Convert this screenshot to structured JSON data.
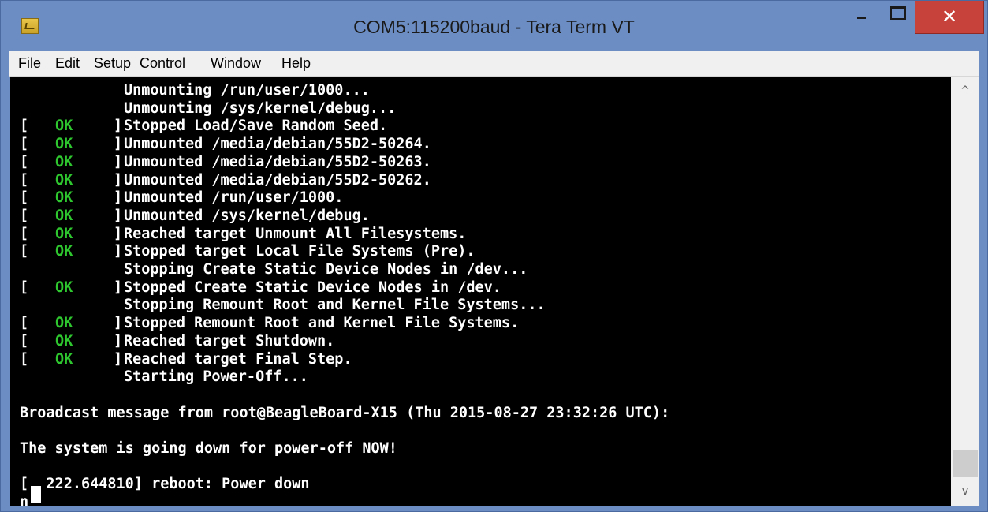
{
  "window": {
    "title": "COM5:115200baud - Tera Term VT",
    "close_glyph": "✕"
  },
  "menu": {
    "items": [
      {
        "accel": "F",
        "rest": "ile"
      },
      {
        "accel": "E",
        "rest": "dit"
      },
      {
        "accel": "S",
        "rest": "etup"
      },
      {
        "pre": "C",
        "accel": "o",
        "rest": "ntrol"
      },
      {
        "accel": "W",
        "rest": "indow"
      },
      {
        "accel": "H",
        "rest": "elp"
      }
    ]
  },
  "terminal": {
    "status_open": "[",
    "status_ok": "OK",
    "status_close": "]",
    "lines": [
      {
        "kind": "indent",
        "text": "Unmounting /run/user/1000..."
      },
      {
        "kind": "indent",
        "text": "Unmounting /sys/kernel/debug..."
      },
      {
        "kind": "ok",
        "text": "Stopped Load/Save Random Seed."
      },
      {
        "kind": "ok",
        "text": "Unmounted /media/debian/55D2-50264."
      },
      {
        "kind": "ok",
        "text": "Unmounted /media/debian/55D2-50263."
      },
      {
        "kind": "ok",
        "text": "Unmounted /media/debian/55D2-50262."
      },
      {
        "kind": "ok",
        "text": "Unmounted /run/user/1000."
      },
      {
        "kind": "ok",
        "text": "Unmounted /sys/kernel/debug."
      },
      {
        "kind": "ok",
        "text": "Reached target Unmount All Filesystems."
      },
      {
        "kind": "ok",
        "text": "Stopped target Local File Systems (Pre)."
      },
      {
        "kind": "indent",
        "text": "Stopping Create Static Device Nodes in /dev..."
      },
      {
        "kind": "ok",
        "text": "Stopped Create Static Device Nodes in /dev."
      },
      {
        "kind": "indent",
        "text": "Stopping Remount Root and Kernel File Systems..."
      },
      {
        "kind": "ok",
        "text": "Stopped Remount Root and Kernel File Systems."
      },
      {
        "kind": "ok",
        "text": "Reached target Shutdown."
      },
      {
        "kind": "ok",
        "text": "Reached target Final Step."
      },
      {
        "kind": "indent",
        "text": "Starting Power-Off..."
      },
      {
        "kind": "blank",
        "text": ""
      },
      {
        "kind": "plain",
        "text": "Broadcast message from root@BeagleBoard-X15 (Thu 2015-08-27 23:32:26 UTC):"
      },
      {
        "kind": "blank",
        "text": ""
      },
      {
        "kind": "plain",
        "text": "The system is going down for power-off NOW!"
      },
      {
        "kind": "blank",
        "text": ""
      },
      {
        "kind": "plain",
        "text": "[  222.644810] reboot: Power down"
      },
      {
        "kind": "plain",
        "text": "n"
      }
    ]
  },
  "scrollbar": {
    "up_glyph": "^",
    "down_glyph": "v"
  }
}
